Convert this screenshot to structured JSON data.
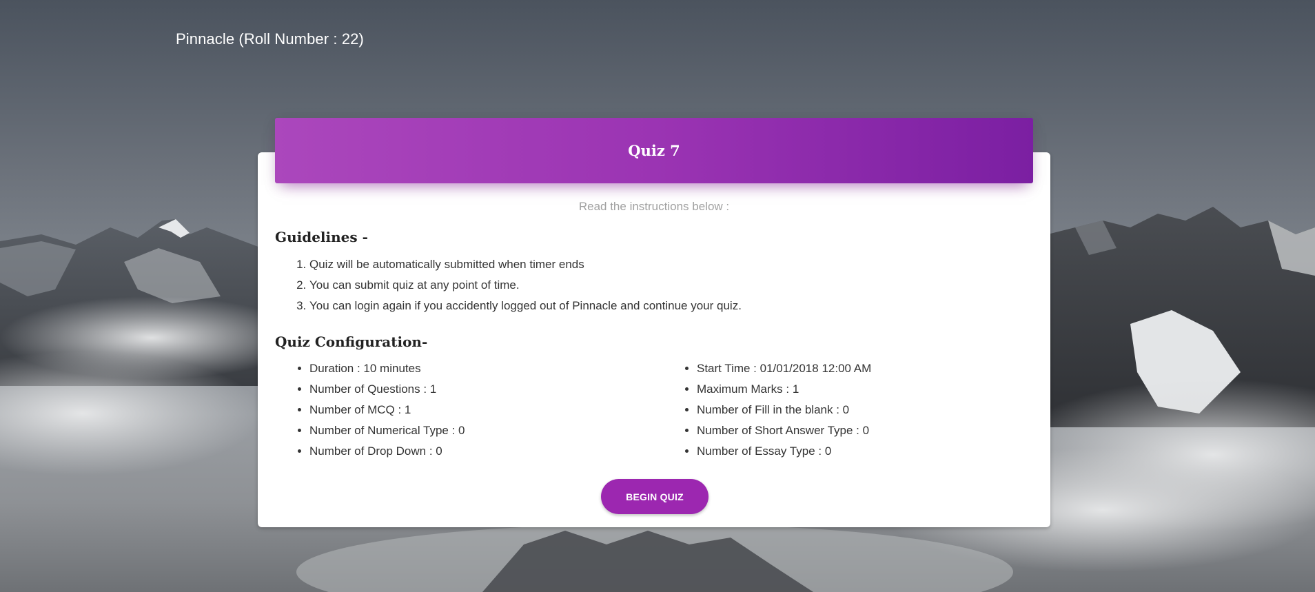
{
  "header": {
    "brand": "Pinnacle (Roll Number : 22)"
  },
  "quiz": {
    "title": "Quiz 7",
    "subtitle": "Read the instructions below :",
    "guidelines_heading": "Guidelines -",
    "guidelines": [
      "Quiz will be automatically submitted when timer ends",
      "You can submit quiz at any point of time.",
      "You can login again if you accidently logged out of Pinnacle and continue your quiz."
    ],
    "config_heading": "Quiz Configuration-",
    "config_left": [
      "Duration : 10 minutes",
      "Number of Questions : 1",
      "Number of MCQ : 1",
      "Number of Numerical Type : 0",
      "Number of Drop Down : 0"
    ],
    "config_right": [
      "Start Time : 01/01/2018 12:00 AM",
      "Maximum Marks : 1",
      "Number of Fill in the blank : 0",
      "Number of Short Answer Type : 0",
      "Number of Essay Type : 0"
    ],
    "begin_label": "BEGIN QUIZ"
  },
  "colors": {
    "accent": "#9c27b0",
    "header_gradient_start": "#ab47bc",
    "header_gradient_end": "#7b1fa2"
  }
}
